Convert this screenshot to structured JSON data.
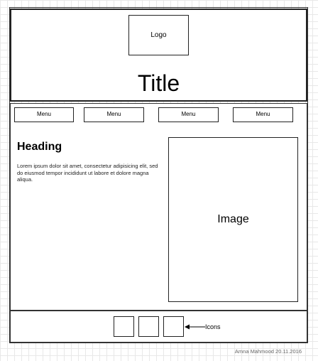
{
  "header": {
    "logo_label": "Logo",
    "title": "Title"
  },
  "menu": {
    "items": [
      {
        "label": "Menu"
      },
      {
        "label": "Menu"
      },
      {
        "label": "Menu"
      },
      {
        "label": "Menu"
      }
    ]
  },
  "main": {
    "heading": "Heading",
    "body": "Lorem ipsum dolor sit amet, consectetur adipisicing elit, sed do eiusmod tempor incididunt ut labore et dolore magna aliqua.",
    "image_label": "Image"
  },
  "footer": {
    "icons_label": "Icons",
    "icon_count": 3
  },
  "signature": "Amna Mahmood 20.11.2016",
  "colors": {
    "grid": "#e8e8e8",
    "stroke": "#222222",
    "background": "#ffffff"
  }
}
